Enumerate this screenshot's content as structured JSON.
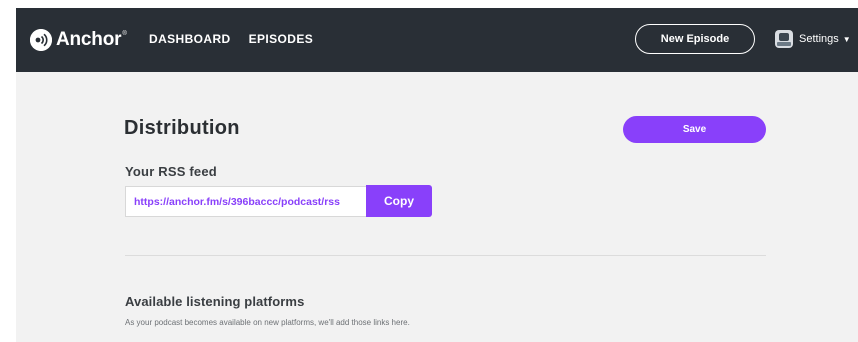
{
  "app": {
    "brand": "Anchor",
    "brand_mark": "®",
    "colors": {
      "topbar": "#292f36",
      "accent": "#8940fa",
      "background": "#f2f2f2"
    }
  },
  "nav": {
    "items": [
      "DASHBOARD",
      "EPISODES"
    ],
    "new_episode_label": "New Episode",
    "settings_label": "Settings",
    "settings_icon": "avatar-icon",
    "caret_icon": "chevron-down-icon"
  },
  "page": {
    "title": "Distribution",
    "save_label": "Save"
  },
  "rss": {
    "label": "Your RSS feed",
    "value": "https://anchor.fm/s/396baccc/podcast/rss",
    "copy_label": "Copy"
  },
  "platforms": {
    "title": "Available listening platforms",
    "subtitle": "As your podcast becomes available on new platforms, we'll add those links here."
  }
}
